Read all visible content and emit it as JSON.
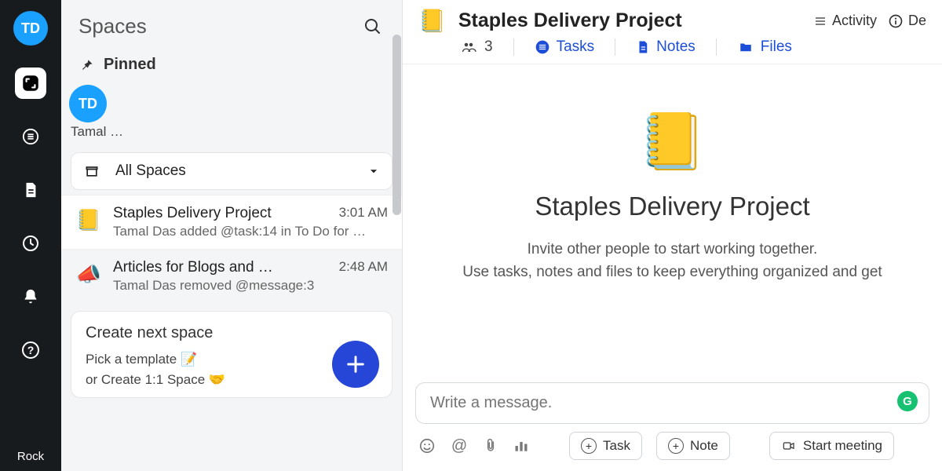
{
  "rail": {
    "avatar_initials": "TD",
    "brand": "Rock"
  },
  "panel": {
    "title": "Spaces",
    "pinned_label": "Pinned",
    "pinned_avatar": "TD",
    "pinned_name": "Tamal …",
    "filter_label": "All Spaces",
    "spaces": [
      {
        "title": "Staples Delivery Project",
        "time": "3:01 AM",
        "sub": "Tamal Das added @task:14 in To Do for …",
        "emoji": "📒"
      },
      {
        "title": "Articles for Blogs and …",
        "time": "2:48 AM",
        "sub": "Tamal Das removed @message:3",
        "emoji": "📣"
      }
    ],
    "create": {
      "title": "Create next space",
      "line1": "Pick a template 📝",
      "line2": "or Create 1:1 Space 🤝"
    }
  },
  "project": {
    "title": "Staples Delivery Project",
    "emoji": "📒",
    "member_count": "3",
    "tabs": {
      "tasks": "Tasks",
      "notes": "Notes",
      "files": "Files"
    },
    "actions": {
      "activity": "Activity",
      "details_initial": "De"
    },
    "hero_sub": "Invite other people to start working together.\nUse tasks, notes and files to keep everything organized and get"
  },
  "compose": {
    "placeholder": "Write a message.",
    "task_btn": "Task",
    "note_btn": "Note",
    "meeting_btn": "Start meeting"
  }
}
